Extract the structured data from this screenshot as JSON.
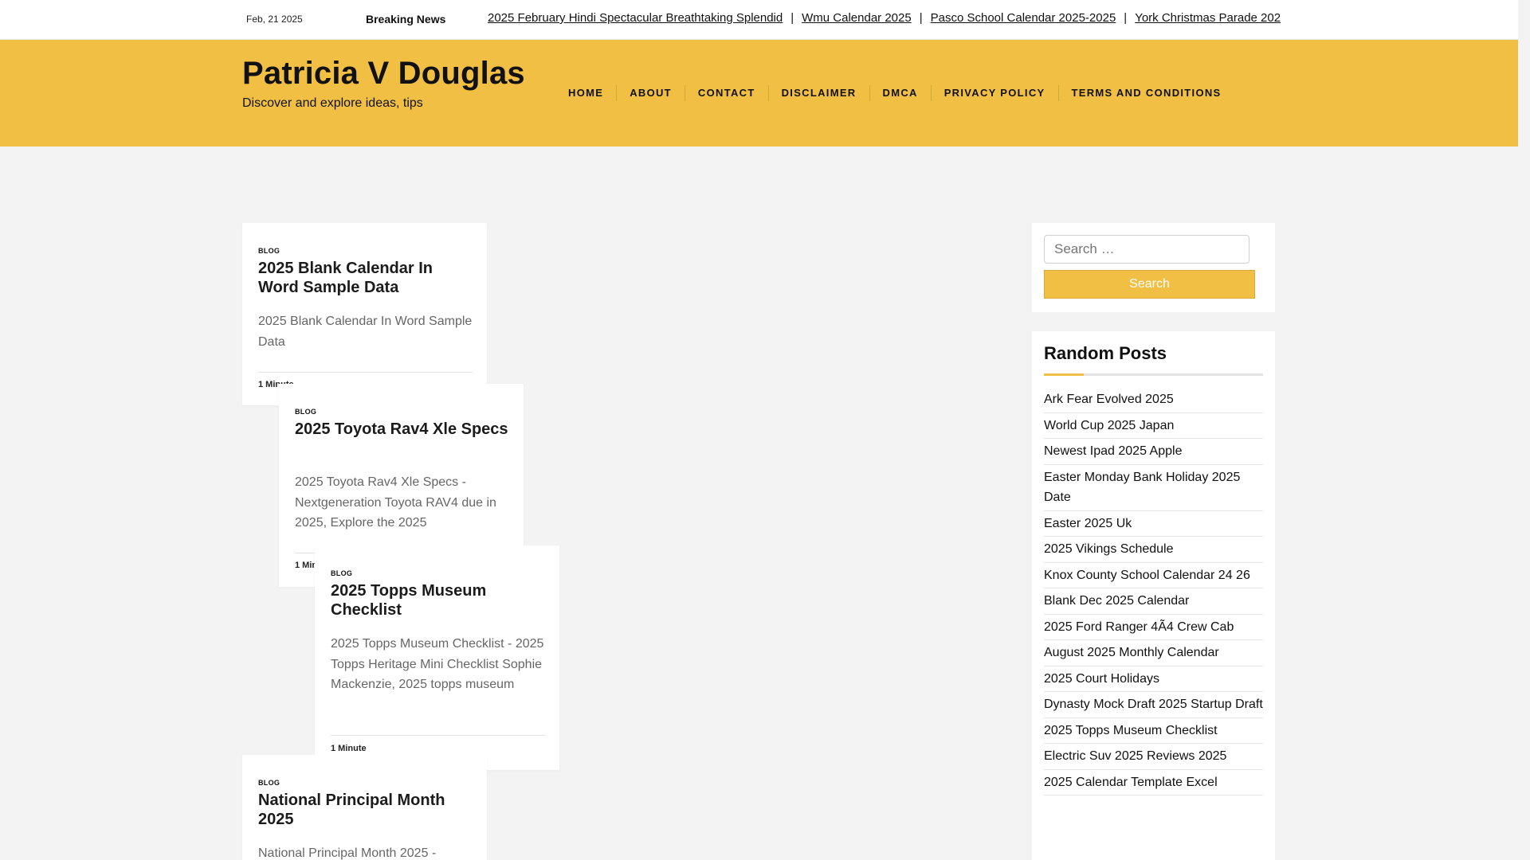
{
  "topbar": {
    "date": "Feb, 21 2025",
    "breaking_label": "Breaking News",
    "ticker": [
      " 2025 February Hindi Spectacular Breathtaking Splendid",
      "Wmu Calendar 2025",
      "Pasco School Calendar 2025-2025",
      "York Christmas Parade 202"
    ],
    "separator": "|"
  },
  "header": {
    "site_title": "Patricia V Douglas",
    "tagline": "Discover and explore ideas, tips",
    "nav": [
      "HOME",
      "ABOUT",
      "CONTACT",
      "DISCLAIMER",
      "DMCA",
      "PRIVACY POLICY",
      "TERMS AND CONDITIONS"
    ]
  },
  "posts": [
    {
      "category": "BLOG",
      "title": "2025 Blank Calendar In Word Sample Data",
      "excerpt": "2025 Blank Calendar In Word Sample Data",
      "read_time": "1 Minute"
    },
    {
      "category": "BLOG",
      "title": "2025 Toyota Rav4 Xle Specs",
      "excerpt": "2025 Toyota Rav4 Xle Specs - Nextgeneration Toyota RAV4 due in 2025, Explore the 2025",
      "read_time": "1 Minute"
    },
    {
      "category": "BLOG",
      "title": "2025 Topps Museum Checklist",
      "excerpt": "2025 Topps Museum Checklist - 2025 Topps Heritage Mini Checklist Sophie Mackenzie, 2025 topps museum",
      "read_time": "1 Minute"
    },
    {
      "category": "BLOG",
      "title": "National Principal Month 2025",
      "excerpt": "National Principal Month 2025 -",
      "read_time": ""
    }
  ],
  "sidebar": {
    "search_placeholder": "Search …",
    "search_button": "Search",
    "random_title": "Random Posts",
    "random_posts": [
      "Ark Fear Evolved 2025",
      "World Cup 2025 Japan",
      "Newest Ipad 2025 Apple",
      "Easter Monday Bank Holiday 2025 Date",
      "Easter 2025 Uk",
      "2025 Vikings Schedule",
      "Knox County School Calendar 24 26",
      "Blank Dec 2025 Calendar",
      "2025 Ford Ranger 4Ã4 Crew Cab",
      "August 2025 Monthly Calendar",
      "2025 Court Holidays",
      "Dynasty Mock Draft 2025 Startup Draft",
      "2025 Topps Museum Checklist",
      "Electric Suv 2025 Reviews 2025",
      "2025 Calendar Template Excel"
    ]
  },
  "colors": {
    "accent": "#f0bf44",
    "background": "#f3f3f3"
  }
}
